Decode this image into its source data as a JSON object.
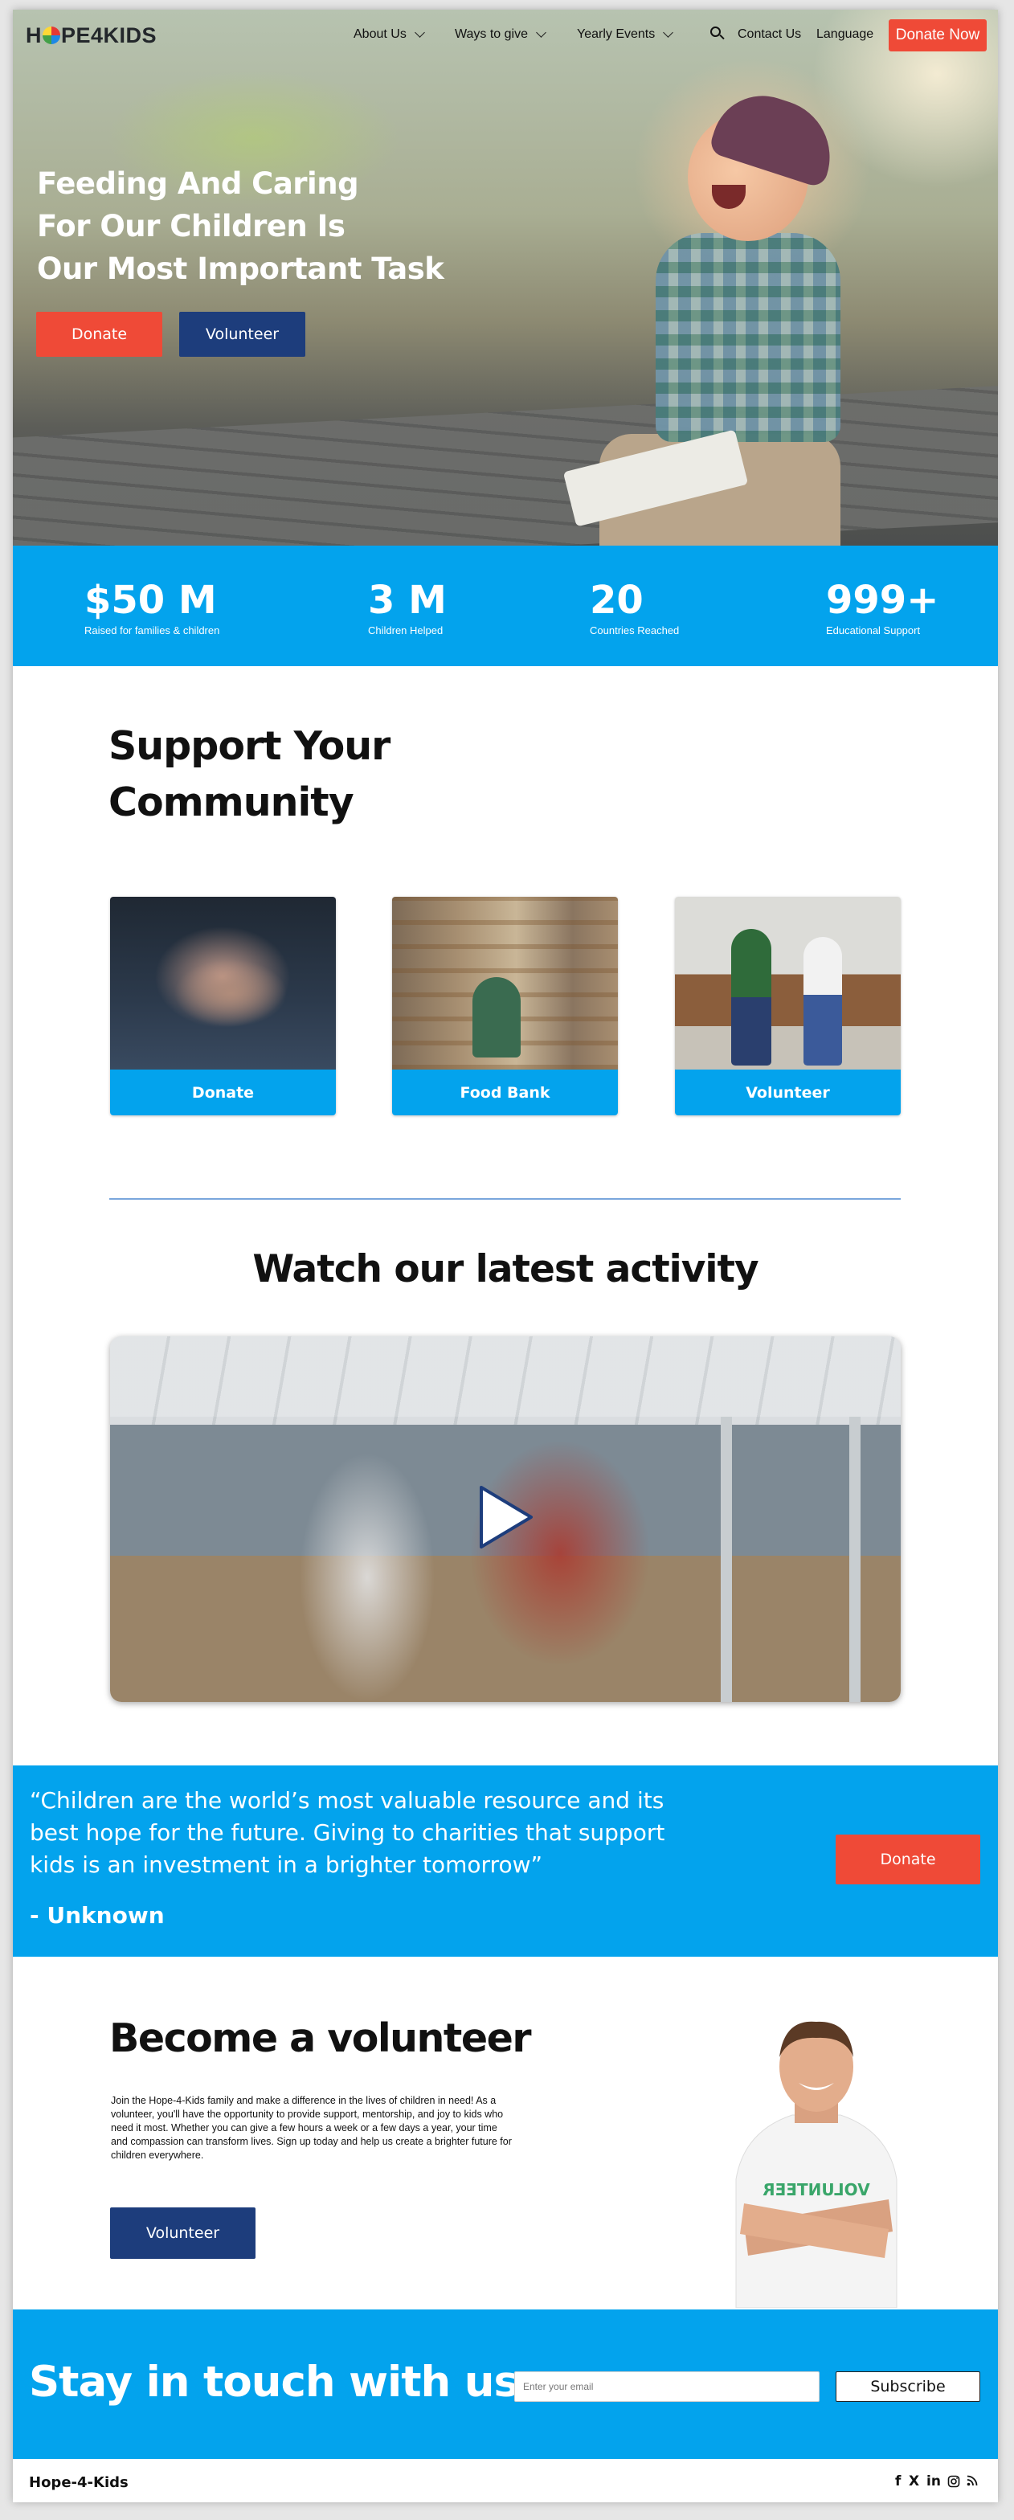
{
  "header": {
    "logo": "HOPE4KIDS",
    "nav": {
      "about": "About Us",
      "ways": "Ways to give",
      "events": "Yearly Events",
      "contact": "Contact Us",
      "language": "Language",
      "donate_now": "Donate Now"
    },
    "icons": {
      "search": "search-icon"
    }
  },
  "hero": {
    "title_lines": [
      "Feeding And Caring",
      "For Our Children Is",
      "Our Most Important Task"
    ],
    "donate_label": "Donate",
    "volunteer_label": "Volunteer"
  },
  "stats": [
    {
      "value": "$50 M",
      "label": "Raised for families & children"
    },
    {
      "value": "3 M",
      "label": "Children Helped"
    },
    {
      "value": "20",
      "label": "Countries Reached"
    },
    {
      "value": "999+",
      "label": "Educational Support"
    }
  ],
  "support": {
    "title_lines": [
      "Support Your",
      "Community"
    ],
    "cards": [
      {
        "label": "Donate"
      },
      {
        "label": "Food Bank"
      },
      {
        "label": "Volunteer"
      }
    ]
  },
  "activity": {
    "title": "Watch our latest activity",
    "icons": {
      "play": "play-icon"
    }
  },
  "quote": {
    "text": "“Children are the world’s most valuable resource and its best hope for the future. Giving to charities that support kids is an investment in a brighter tomorrow”",
    "author": "- Unknown",
    "donate_label": "Donate"
  },
  "volunteer": {
    "title": "Become a volunteer",
    "body": "Join the Hope-4-Kids family and make a difference in the lives of children in need! As a volunteer, you'll have the opportunity to provide support, mentorship, and joy to kids who need it most. Whether you can give a few hours a week or a few days a year, your time and compassion can transform lives. Sign up today and help us create a brighter future for children everywhere.",
    "button_label": "Volunteer",
    "shirt_text": "VOLUNTEER"
  },
  "newsletter": {
    "title": "Stay in touch with us",
    "email_placeholder": "Enter your email",
    "subscribe_label": "Subscribe"
  },
  "footer": {
    "brand": "Hope-4-Kids",
    "social": {
      "facebook": "f",
      "x": "X",
      "linkedin": "in"
    },
    "icons": [
      "facebook-icon",
      "x-icon",
      "linkedin-icon",
      "instagram-icon",
      "rss-icon"
    ]
  },
  "colors": {
    "accent_blue": "#03a3ed",
    "donate_red": "#ef4a37",
    "navy": "#1d3d7c"
  }
}
